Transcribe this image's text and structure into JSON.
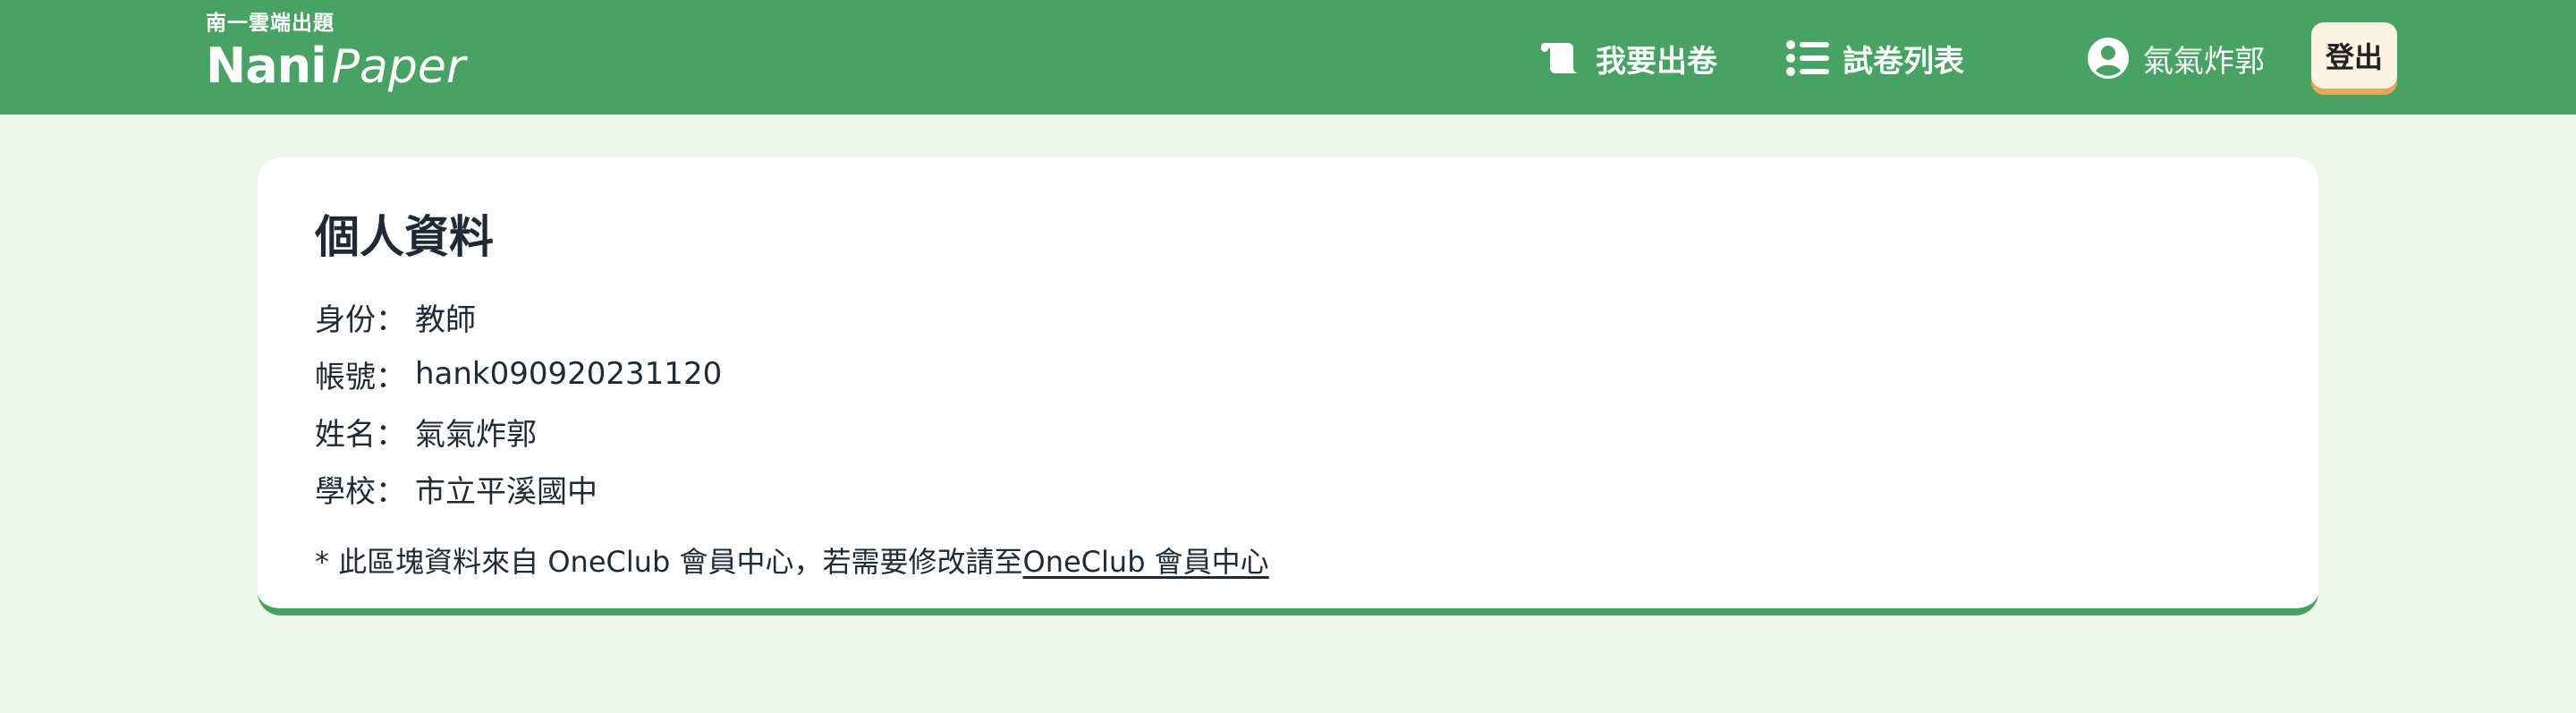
{
  "header": {
    "brand_sub": "南一雲端出題",
    "brand_name_bold": "Nani",
    "brand_name_light": "Paper",
    "nav": {
      "create_label": "我要出卷",
      "list_label": "試卷列表"
    },
    "user_name": "氣氣炸郭",
    "logout_label": "登出",
    "colors": {
      "header_bg": "#48a263",
      "logout_bg": "#fbf3e4",
      "logout_shadow": "#e5a85a"
    },
    "icons": {
      "create": "scroll-icon",
      "list": "list-icon",
      "user": "user-circle-icon"
    }
  },
  "profile": {
    "title": "個人資料",
    "rows": [
      {
        "label": "身份：",
        "value": "教師"
      },
      {
        "label": "帳號：",
        "value": "hank090920231120"
      },
      {
        "label": "姓名：",
        "value": "氣氣炸郭"
      },
      {
        "label": "學校：",
        "value": "市立平溪國中"
      }
    ],
    "note_text": "* 此區塊資料來自 OneClub 會員中心，若需要修改請至 ",
    "note_link": "OneClub 會員中心"
  }
}
